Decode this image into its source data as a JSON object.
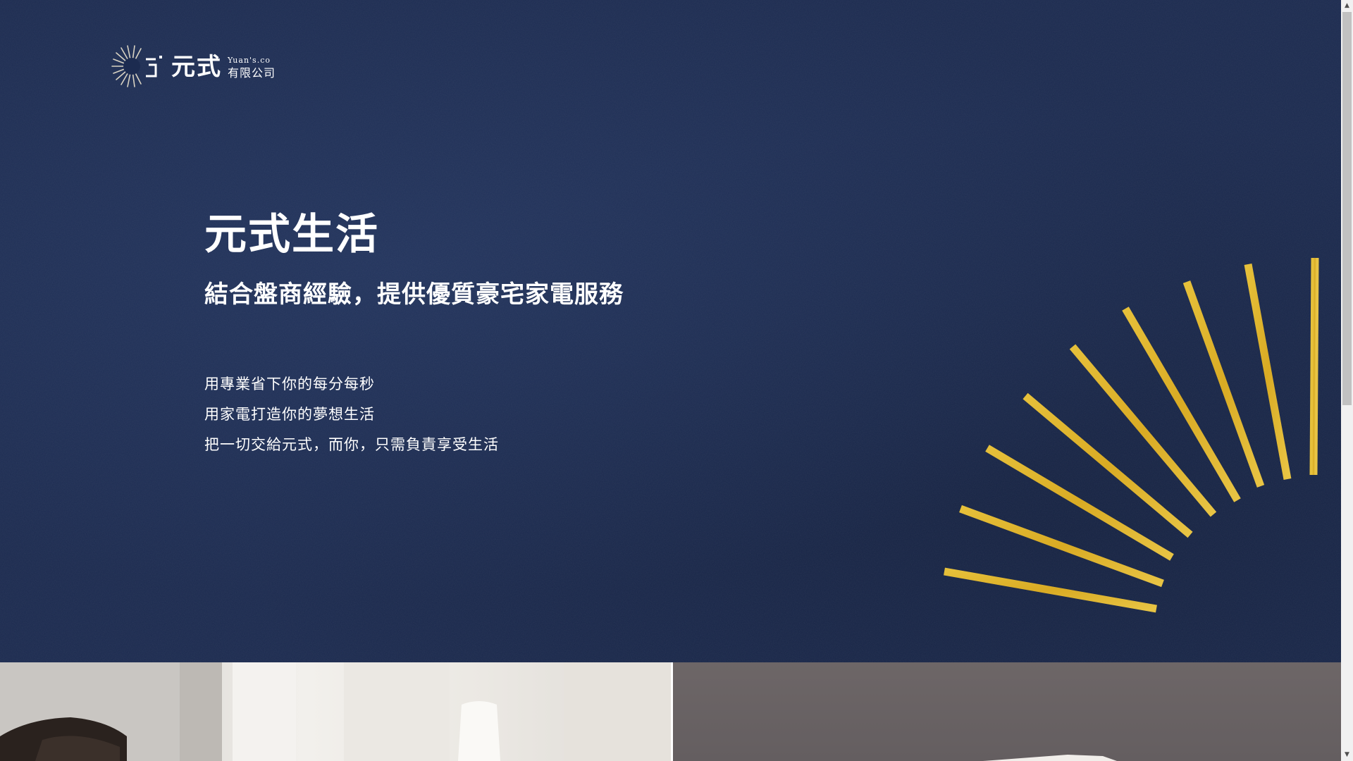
{
  "logo": {
    "main": "元式",
    "sub_en": "Yuan's.co",
    "sub_zh": "有限公司",
    "icon": "sunburst-logo-icon"
  },
  "hero": {
    "title": "元式生活",
    "subtitle": "結合盤商經驗，提供優質豪宅家電服務",
    "taglines": [
      "用專業省下你的每分每秒",
      "用家電打造你的夢想生活",
      "把一切交給元式，而你，只需負責享受生活"
    ],
    "decoration": "gold-rays-graphic"
  },
  "colors": {
    "background": "#1c2b50",
    "gold": "#e2b52d",
    "text": "#ffffff"
  },
  "scrollbar": {
    "up_icon": "▲",
    "down_icon": "▼"
  }
}
